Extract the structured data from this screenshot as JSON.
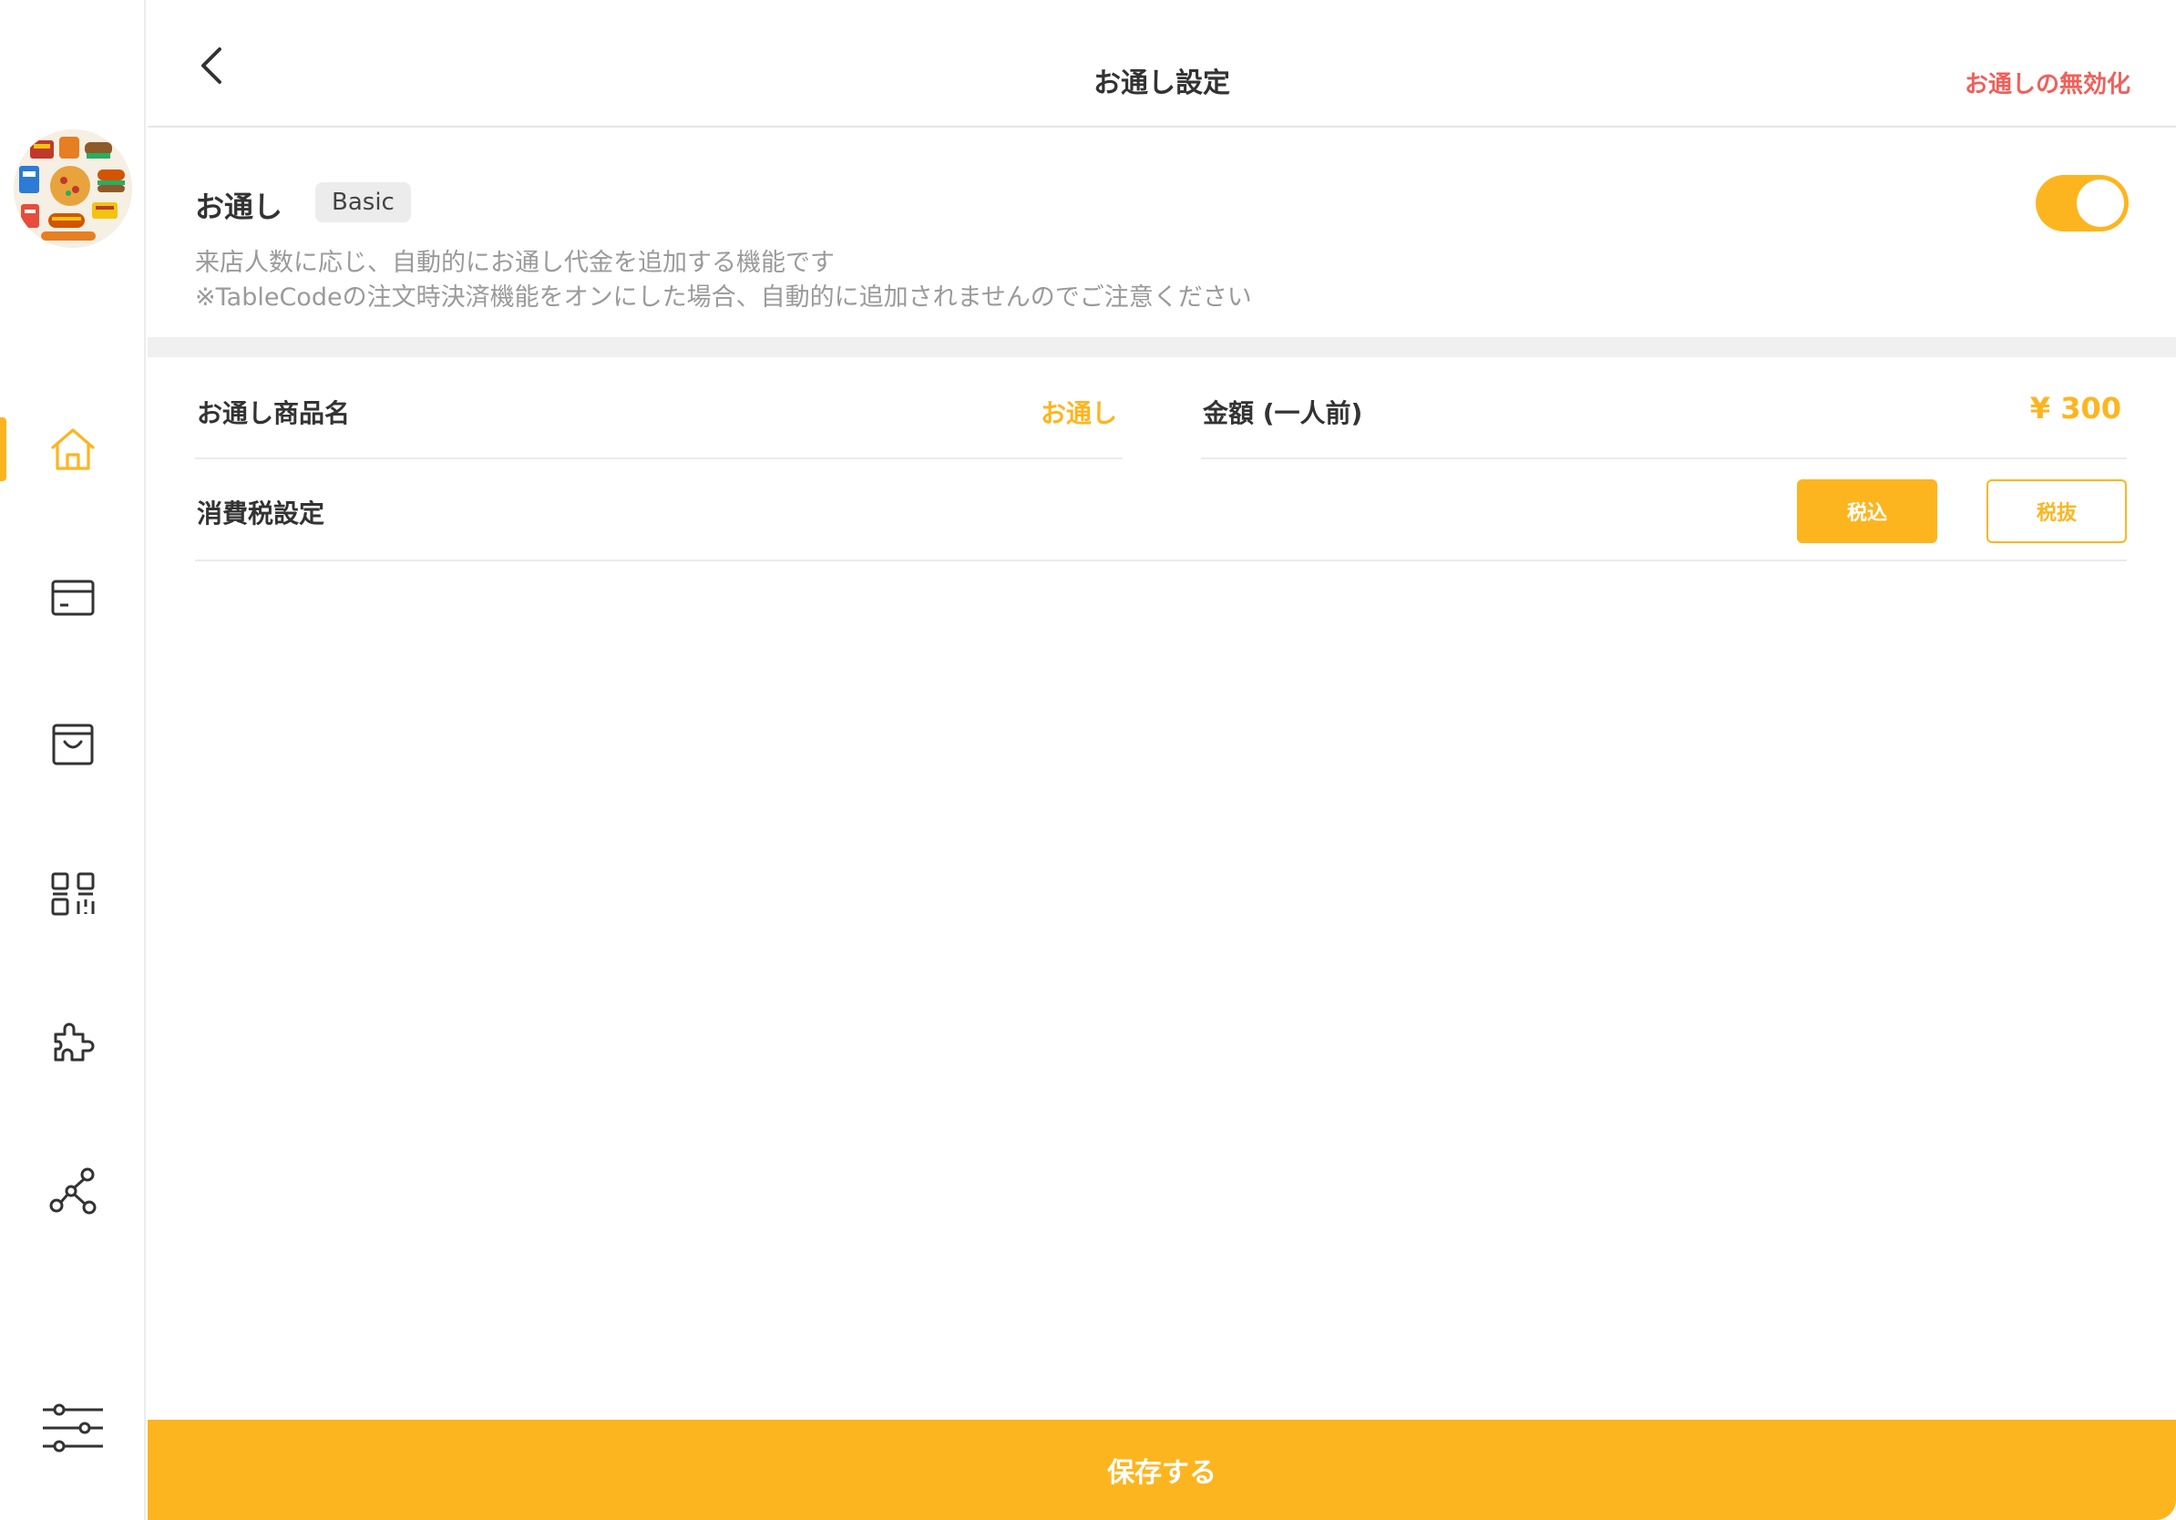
{
  "header": {
    "title": "お通し設定",
    "disable_action": "お通しの無効化"
  },
  "feature": {
    "title": "お通し",
    "plan_badge": "Basic",
    "enabled": true,
    "description_line1": "来店人数に応じ、自動的にお通し代金を追加する機能です",
    "description_line2": "※TableCodeの注文時決済機能をオンにした場合、自動的に追加されませんのでご注意ください"
  },
  "fields": {
    "product_name_label": "お通し商品名",
    "product_name_value": "お通し",
    "price_label": "金額 (一人前)",
    "price_value": "¥ 300",
    "tax_label": "消費税設定",
    "tax_included": "税込",
    "tax_excluded": "税抜",
    "tax_selected": "税込"
  },
  "sidebar": {
    "items": [
      {
        "icon": "home-icon",
        "active": true
      },
      {
        "icon": "card-icon",
        "active": false
      },
      {
        "icon": "shopping-bag-icon",
        "active": false
      },
      {
        "icon": "qr-code-icon",
        "active": false
      },
      {
        "icon": "puzzle-icon",
        "active": false
      },
      {
        "icon": "network-icon",
        "active": false
      }
    ],
    "bottom_icon": "settings-sliders-icon"
  },
  "footer": {
    "save_label": "保存する"
  },
  "colors": {
    "accent": "#fdb51f",
    "danger": "#f0605a",
    "muted_text": "#9a9a9a"
  }
}
